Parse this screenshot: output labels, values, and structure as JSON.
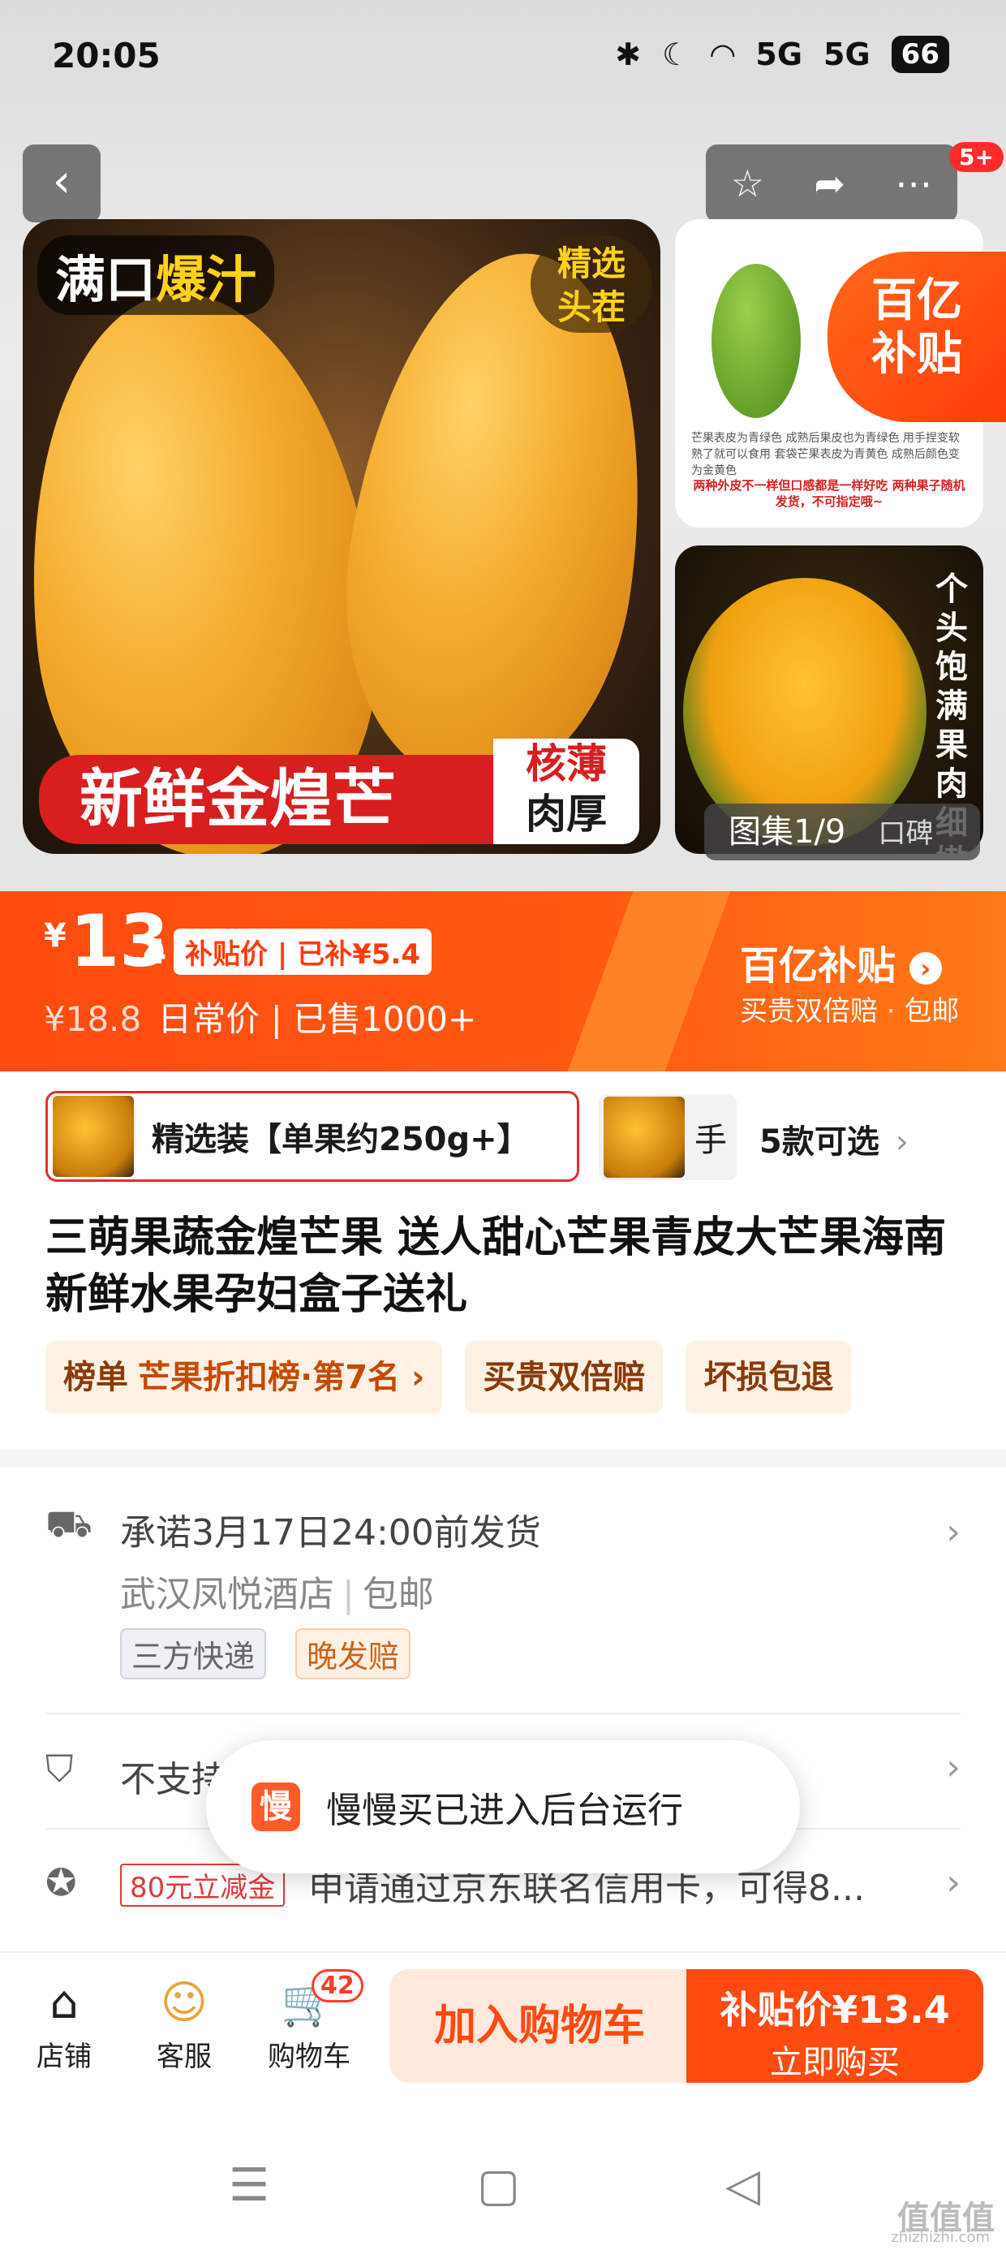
{
  "status_bar": {
    "time": "20:05",
    "net1": "5G",
    "net2": "5G",
    "battery": "66"
  },
  "top_nav": {
    "back": "‹",
    "badge": "5+"
  },
  "hero": {
    "tag_full": [
      "满口",
      "爆汁"
    ],
    "tag_selected": [
      "精选",
      "头茬"
    ],
    "banner_red": "新鲜金煌芒",
    "banner_white": [
      "核薄",
      "肉厚"
    ],
    "side1_caption_left": "芒果表皮为青绿色 成熟后果皮也为青绿色 用手捏变软熟了就可以食用",
    "side1_caption_right": "套袋芒果表皮为青黄色 成熟后颜色变为金黄色",
    "side1_caption_bottom": "两种外皮不一样但口感都是一样好吃 两种果子随机发货，不可指定哦~",
    "subsidy_badge": [
      "百亿",
      "补贴"
    ],
    "side2_vertical": "个头饱满果肉细嫩",
    "gallery_label": "图集1/9",
    "gallery_extra": "口碑"
  },
  "price": {
    "currency": "¥",
    "int": "13",
    "dec": ".4",
    "subsidy_tag": "补贴价 | 已补¥5.4",
    "old": "¥18.8",
    "daily": "日常价",
    "sold": "已售1000+",
    "brand": "百亿补贴",
    "brand_arrow": "›",
    "brand_sub": "买贵双倍赔 · 包邮"
  },
  "variants": {
    "selected": "精选装【单果约250g+】",
    "next": "手",
    "more": "5款可选"
  },
  "product_title": "三萌果蔬金煌芒果 送人甜心芒果青皮大芒果海南新鲜水果孕妇盒子送礼",
  "tags": {
    "rank_label": "榜单",
    "rank_value": "芒果折扣榜·第7名 ›",
    "t2": "买贵双倍赔",
    "t3": "坏损包退"
  },
  "shipping": {
    "promise": "承诺3月17日24:00前发货",
    "origin": "武汉凤悦酒店",
    "free": "包邮",
    "chip1": "三方快递",
    "chip2": "晚发赔"
  },
  "service": {
    "text": "不支持"
  },
  "offer": {
    "coupon": "80元立减金",
    "text": "申请通过京东联名信用卡，可得8..."
  },
  "toast": {
    "logo": "慢",
    "text": "慢慢买已进入后台运行"
  },
  "bottom": {
    "shop": "店铺",
    "service": "客服",
    "cart": "购物车",
    "cart_count": "42",
    "add_cart": "加入购物车",
    "buy_line1": "补贴价¥13.4",
    "buy_line2": "立即购买"
  },
  "watermark": {
    "main": "值值值",
    "sub": "zhizhizhi.com"
  },
  "colors": {
    "accent": "#ff4a10",
    "tag_bg": "#fdf1e4",
    "red": "#e02e2e"
  }
}
